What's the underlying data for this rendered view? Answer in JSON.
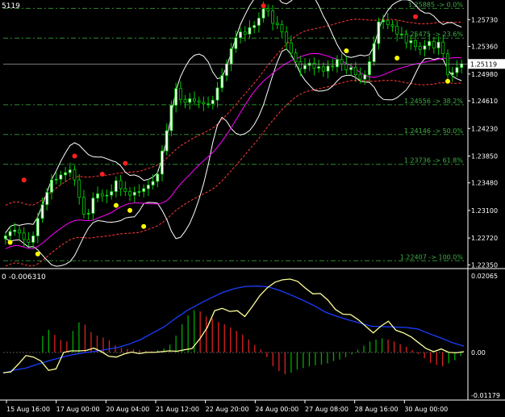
{
  "header": {
    "main_label": "5119",
    "osc_label": "0 -0.006310"
  },
  "colors": {
    "background": "#000000",
    "axis": "#ffffff",
    "bull_candle": "#ffffff",
    "bear_candle": "#000000",
    "candle_wick": "#00cc00",
    "fib_line": "#2e8b2e",
    "fib_text": "#3cb043",
    "bands_outer": "#ffffff",
    "bands_inner_ma": "#ff00ff",
    "envelope": "#ff3b3b",
    "osc_signal": "#1a3dff",
    "osc_main": "#ffff99",
    "hist_up": "#00aa00",
    "hist_down": "#dd2222",
    "fractal_up": "#ff2020",
    "fractal_down": "#ffff00"
  },
  "chart_data": [
    {
      "type": "candlestick",
      "symbol_price_tail": "5119",
      "current_price": "1.25119",
      "y_axis_ticks": [
        "1.25730",
        "1.25360",
        "1.24980",
        "1.24610",
        "1.24230",
        "1.23850",
        "1.23480",
        "1.23100",
        "1.22720",
        "1.22350"
      ],
      "y_axis_values": [
        1.2573,
        1.2536,
        1.2498,
        1.2461,
        1.2423,
        1.2385,
        1.2348,
        1.231,
        1.2272,
        1.2235
      ],
      "ylim": [
        1.2231,
        1.26
      ],
      "x_axis_labels": [
        "15 Aug 16:00",
        "17 Aug 00:00",
        "20 Aug 04:00",
        "21 Aug 12:00",
        "22 Aug 20:00",
        "24 Aug 00:00",
        "27 Aug 08:00",
        "28 Aug 16:00",
        "30 Aug 00:00"
      ],
      "fibonacci_levels": [
        {
          "price": 1.25885,
          "label": "1.25885 -> 0.0%"
        },
        {
          "price": 1.25475,
          "label": "1.25475 -> 23.6%"
        },
        {
          "price": 1.24556,
          "label": "1.24556 -> 38.2%"
        },
        {
          "price": 1.24146,
          "label": "1.24146 -> 50.0%"
        },
        {
          "price": 1.23736,
          "label": "1.23736 -> 61.8%"
        },
        {
          "price": 1.22407,
          "label": "1.22407 -> 100.0%"
        }
      ],
      "price_series_close": [
        1.2275,
        1.2281,
        1.2283,
        1.2279,
        1.227,
        1.2266,
        1.2275,
        1.2299,
        1.2318,
        1.2335,
        1.2352,
        1.2353,
        1.2359,
        1.2362,
        1.2366,
        1.2352,
        1.2328,
        1.2305,
        1.2306,
        1.2327,
        1.2333,
        1.233,
        1.2331,
        1.2336,
        1.2351,
        1.234,
        1.2336,
        1.2331,
        1.2335,
        1.2336,
        1.234,
        1.2345,
        1.235,
        1.236,
        1.2392,
        1.242,
        1.2455,
        1.2478,
        1.2463,
        1.2459,
        1.2464,
        1.2461,
        1.2459,
        1.2457,
        1.2457,
        1.2462,
        1.2479,
        1.2496,
        1.2512,
        1.2533,
        1.2548,
        1.2556,
        1.2553,
        1.2562,
        1.2565,
        1.2575,
        1.2588,
        1.2585,
        1.2568,
        1.2566,
        1.2556,
        1.2541,
        1.2527,
        1.2515,
        1.2505,
        1.251,
        1.2513,
        1.2506,
        1.2508,
        1.2502,
        1.2509,
        1.2508,
        1.2518,
        1.2512,
        1.2504,
        1.2507,
        1.2497,
        1.2491,
        1.2497,
        1.2515,
        1.254,
        1.257,
        1.2572,
        1.2566,
        1.2564,
        1.2553,
        1.2553,
        1.2541,
        1.2544,
        1.2536,
        1.2532,
        1.2537,
        1.2543,
        1.2534,
        1.2542,
        1.2526,
        1.2497,
        1.25,
        1.2507,
        1.2512
      ],
      "fractals_up": [
        [
          4,
          1.2352
        ],
        [
          15,
          1.2385
        ],
        [
          21,
          1.236
        ],
        [
          26,
          1.2375
        ],
        [
          56,
          1.2592
        ],
        [
          89,
          1.2577
        ]
      ],
      "fractals_down": [
        [
          1,
          1.2266
        ],
        [
          7,
          1.225
        ],
        [
          24,
          1.2317
        ],
        [
          27,
          1.231
        ],
        [
          30,
          1.2288
        ],
        [
          74,
          1.253
        ],
        [
          85,
          1.252
        ],
        [
          96,
          1.2488
        ]
      ]
    },
    {
      "type": "oscillator",
      "y_axis_ticks": [
        "0.02065",
        "0.00",
        "-0.01179"
      ],
      "ylim": [
        -0.01179,
        0.02065
      ],
      "histogram": [
        0,
        0,
        0,
        0,
        0,
        0,
        0.0042,
        0.0058,
        0.0045,
        0.0032,
        0.0028,
        0.0055,
        0.0077,
        0.0071,
        0.0052,
        0.0043,
        0.0038,
        0.0031,
        0.0018,
        0.0012,
        0.0009,
        0.0008,
        0.0006,
        0.0004,
        0.0003,
        0.0006,
        0.001,
        0.002,
        0.0043,
        0.0072,
        0.0095,
        0.0108,
        0.0105,
        0.0092,
        0.0087,
        0.0078,
        0.0072,
        0.0064,
        0.0055,
        0.0046,
        0.0033,
        0.0019,
        0.0008,
        -0.0012,
        -0.0035,
        -0.0048,
        -0.0056,
        -0.0052,
        -0.0044,
        -0.004,
        -0.0036,
        -0.0033,
        -0.0031,
        -0.0028,
        -0.0022,
        -0.0018,
        -0.0012,
        -0.0005,
        0.0007,
        0.0017,
        0.0028,
        0.0033,
        0.0036,
        0.0033,
        0.0028,
        0.0021,
        0.0014,
        0.0006,
        -0.0004,
        -0.0015,
        -0.0027,
        -0.0032,
        -0.0036,
        -0.0028,
        -0.002,
        -0.0009
      ],
      "main_line": [
        -0.0052,
        -0.005,
        -0.003,
        -0.0008,
        -0.0012,
        -0.0022,
        -0.0046,
        -0.0042,
        0.0,
        0.0004,
        0.0004,
        0.0005,
        0.0011,
        0.0002,
        -0.001,
        -0.0012,
        -0.0004,
        0.0001,
        -0.0003,
        0.0,
        0.0,
        0.0002,
        0.0004,
        0.0003,
        0.0007,
        0.001,
        0.0034,
        0.0063,
        0.0107,
        0.0113,
        0.0105,
        0.0107,
        0.0092,
        0.0118,
        0.0146,
        0.0166,
        0.018,
        0.0186,
        0.0188,
        0.0182,
        0.0165,
        0.015,
        0.0151,
        0.0134,
        0.011,
        0.0098,
        0.0097,
        0.0084,
        0.0067,
        0.005,
        0.0067,
        0.008,
        0.0057,
        0.005,
        0.004,
        0.0025,
        0.001,
        0.0002,
        0.0009,
        0.0,
        -0.0001,
        0.0002
      ],
      "signal_line": [
        -0.0053,
        -0.0045,
        -0.004,
        -0.003,
        -0.0021,
        -0.0013,
        -0.0006,
        -0.0001,
        0.0003,
        0.0008,
        0.0013,
        0.0022,
        0.0034,
        0.005,
        0.0066,
        0.0088,
        0.0108,
        0.0124,
        0.0139,
        0.0153,
        0.0163,
        0.0169,
        0.017,
        0.0168,
        0.0159,
        0.0147,
        0.0134,
        0.012,
        0.0103,
        0.0092,
        0.0083,
        0.0075,
        0.0067,
        0.0066,
        0.0065,
        0.0064,
        0.006,
        0.0048,
        0.0037,
        0.0025,
        0.0016
      ]
    }
  ]
}
